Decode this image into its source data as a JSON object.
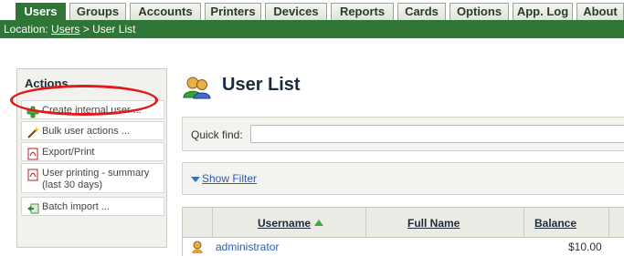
{
  "tabs": [
    {
      "label": "Users",
      "active": true
    },
    {
      "label": "Groups"
    },
    {
      "label": "Accounts"
    },
    {
      "label": "Printers"
    },
    {
      "label": "Devices"
    },
    {
      "label": "Reports"
    },
    {
      "label": "Cards"
    },
    {
      "label": "Options"
    },
    {
      "label": "App. Log"
    },
    {
      "label": "About"
    }
  ],
  "location": {
    "prefix": "Location:",
    "link": "Users",
    "separator": ">",
    "current": "User List"
  },
  "actions": {
    "title": "Actions",
    "items": [
      {
        "label": "Create internal user ...",
        "icon": "green-plus-icon"
      },
      {
        "label": "Bulk user actions ...",
        "icon": "magic-wand-icon"
      },
      {
        "label": "Export/Print",
        "icon": "pdf-icon"
      },
      {
        "label": "User printing - summary (last 30 days)",
        "icon": "pdf-icon"
      },
      {
        "label": "Batch import ...",
        "icon": "import-icon"
      }
    ]
  },
  "main": {
    "title": "User List",
    "quick_find_label": "Quick find:",
    "quick_find_value": "",
    "show_filter": "Show Filter"
  },
  "table": {
    "columns": [
      "Username",
      "Full Name",
      "Balance"
    ],
    "sorted_column": "Username",
    "rows": [
      {
        "username": "administrator",
        "full_name": "",
        "balance": "$10.00"
      }
    ]
  },
  "colors": {
    "accent_green": "#2f7535",
    "link_blue": "#2b5fb3",
    "highlight_red": "#e01919"
  }
}
